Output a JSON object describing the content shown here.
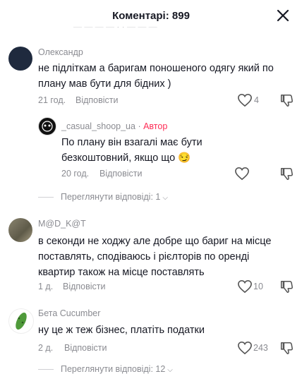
{
  "header": {
    "title": "Коментарі: 899"
  },
  "cut_off_text": "— — — —  · ·  — — —",
  "comments": [
    {
      "username": "Олександр",
      "text": "не підліткам а баригам поношеного одягу який по плану мав бути для бідних )",
      "time": "21 год.",
      "reply_label": "Відповісти",
      "likes": "4"
    },
    {
      "username": "_casual_shoop_ua",
      "author_label": "Автор",
      "text": "По плану він взагалі має бути безкоштовний, якщо що 😏",
      "time": "20 год.",
      "reply_label": "Відповісти",
      "likes": ""
    },
    {
      "username": "M@D_K@T",
      "text": "в секонди не ходжу але добре що бариг на місце поставлять, сподіваюсь і рієлторів по оренді квартир також на місце поставлять",
      "time": "1 д.",
      "reply_label": "Відповісти",
      "likes": "10"
    },
    {
      "username": "Бета Cucumber",
      "text": "ну це ж теж бізнес, платіть податки",
      "time": "2 д.",
      "reply_label": "Відповісти",
      "likes": "243"
    }
  ],
  "view_replies": [
    {
      "label": "Переглянути відповіді: 1"
    },
    {
      "label": "Переглянути відповіді: 12"
    }
  ],
  "icons": {
    "close": "close-icon",
    "like": "heart-outline-icon",
    "dislike": "thumbs-down-outline-icon",
    "chevron": "chevron-down-icon"
  },
  "colors": {
    "text": "#161823",
    "muted": "#8a8b91",
    "author": "#fe2c55"
  }
}
